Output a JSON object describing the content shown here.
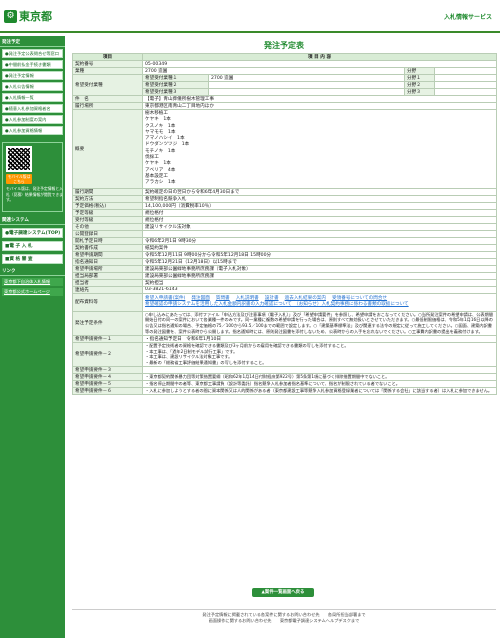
{
  "header": {
    "logo_text": "東京都",
    "service_title": "入札情報サービス"
  },
  "sidebar": {
    "head_label": "発注予定",
    "links": [
      "●発注予定公表問合せ等窓口",
      "●中間前払金手続き書類",
      "●発注予定情報",
      "●入札公告情報",
      "●入札情報一覧",
      "●随意入札参加資格者名",
      "●入札参加制度の案内",
      "●入札参加資格情報"
    ],
    "mobile": {
      "badge": "モバイル版はこちら",
      "text": "モバイル版は、発注予定情報と入札（見積）結果情報が閲覧できます。"
    },
    "system_head": "関連システム",
    "system_buttons": [
      "●電子調達システム(TOP)",
      "■電 子 入 札",
      "■資 格 審 査"
    ],
    "links_head": "リンク",
    "link_items": [
      "東京都下自治体入札情報",
      "東京都公式ホームページ"
    ]
  },
  "page": {
    "title": "発注予定表",
    "col_item": "項目",
    "col_content": "項 目 内 容",
    "rows": [
      {
        "label": "契約番号",
        "value": "05-00349"
      },
      {
        "label": "業種",
        "value": "2700 造園"
      },
      {
        "label": "業種",
        "value": ""
      }
    ],
    "contract_no": "05-00349",
    "gyoshu": "2700 造園",
    "bunya_label": "分野",
    "bunya1": "分野１",
    "bunya2": "分野２",
    "bunya3": "分野３",
    "kibo_label": "希望受付業種",
    "kibo1_label": "希望受付業種１",
    "kibo1_value": "2700 造園",
    "kibo2_label": "希望受付業種２",
    "kibo3_label": "希望受付業種３",
    "kenmei_label": "件　名",
    "kenmei_value": "【電子】青山葬儀所樹木管理工事",
    "basho_label": "履行場所",
    "basho_value": "東京都港区南青山二丁目地内ほか",
    "gaiyo_label": "概要",
    "gaiyo_lines": [
      "樹木移植工",
      "ケヤキ　1本",
      "クスノキ　1本",
      "ヤマモモ　1本",
      "アマノハシイ　1本",
      "ドウダンツツジ　1本",
      "モチノキ　1本",
      "伐採工",
      "ケヤキ　1本",
      "アベリア　4本",
      "基本設定工",
      "アラカシ　1本"
    ],
    "kikan_label": "履行期間",
    "kikan_value": "契約確定の日の翌日から令和6年4月30日まで",
    "hoho_label": "契約方法",
    "hoho_value": "希望制指名競争入札",
    "yotei_label": "予定価格(税込)",
    "yotei_value": "14,100,000円（消費税率10％）",
    "yoken_label": "予定等級",
    "yoken_value": "規位格付",
    "juryo_label": "受付等級",
    "juryo_value": "規位格付",
    "sonota_label": "その他",
    "sonota_value": "建設リサイクル法対象",
    "kokai_label": "公開登録日",
    "kokai_value": "",
    "kaisatsu_label": "開札予定日時",
    "kaisatsu_value": "令和6年2月1日 9時30分",
    "kessai_label": "契約書作成",
    "kessai_value": "紙契約案件",
    "kibo_uke_label": "希望申請期間",
    "kibo_uke_value": "令和5年12月11日 9時00分から令和5年12月18日 15時00分",
    "shimei_label": "指名通知日",
    "shimei_value": "令和5年12月21日（12月18日）以15時まで",
    "kibo_kyoku_label": "希望申請場所",
    "kibo_kyoku_value": "建設局東部公園緑地事務所庶務課（電子入札対象）",
    "tanto_label": "担当局部署",
    "tanto_value": "建設局東部公園緑地事務所庶務課",
    "tantosha_label": "担当者",
    "tantosha_value": "契約担当",
    "renraku_label": "連絡先",
    "renraku_value": "03-3821-6143",
    "haifu_label": "配布資料等",
    "haifu_links": [
      "希望入申請書(案件)",
      "発注図面",
      "質問書",
      "入札説明書",
      "設計書",
      "過去入札結果の案内",
      "受領番号についての問合せ"
    ],
    "haifu_note": "希望確認の申請システムを活用した入札金額内訳書の入力確認について　（お知らせ）入札契約事務に係わる書類の取扱について",
    "joken_label": "発注予定条件",
    "joken_text": "○申し込みにあたっては、添付ファイル「申込方法及び注意事項（電子入札）」及び「希望申請要件」を参照し、希望申請をおこなってください。○当所発注案件の希望申請は、公表期間開始日付の同一の案件において各業種一件のみです。同一業種に複数の希望申請を行った場合は、原則すべて無効扱いとさせていただきます。○最低制限価格は、令和5年1月16日以降の公告又は指名通知の場合、予定価格の75／100から93.5／100までの範囲で設定します。○「建築基準標準法」及び関連する法令の規定に従って施工してください。○図面、建築内訳書等の発注図書を、案件公表時から公開します。指名通知時には、原則発注図書を添付しないため、公表時からの入手を忘れないでください。○工事費内訳書の提出を義務付けます。",
    "youken_label": "希望申請要件",
    "youken": [
      {
        "no": "希望申請要件－１",
        "text": "・指名通知予定日　令和6年1月10日"
      },
      {
        "no": "希望申請要件－２",
        "text": "・配置予定技術者の資格を確認できる書類及び3ヶ月前からの雇用を確認できる書類の写しを添付すること。"
      },
      {
        "no": "希望申請要件－３",
        "text": ""
      },
      {
        "no": "希望申請要件－４",
        "text": "・東京都契約関係暴力団等対策措置要綱（昭和62年1月14日付財経庶第922号）第5条第1項に基づく排除措置期間中でないこと。"
      },
      {
        "no": "希望申請要件－５",
        "text": "・指名停止期間中の者等、東京都工事請負（設計等委託）指名競争入札参加者指名基準について、指名が制限されている者でないこと。"
      },
      {
        "no": "希望申請要件－６",
        "text": "・入札に参加しようとする者の間に資本関係又は人的関係がある者（東京都建設工事等競争入札参加資格登録業者については「関係する会社」に該当する者）は入札に参加できません。"
      }
    ],
    "youken2_lines": [
      "・本工事は、「過年2日制モデル試行工事」です。",
      "・本工事は、建設リサイクル法対象工事です。",
      "・最新の「総務省工事評価結果通知書」の写しを添付すること。"
    ],
    "back_button": "▲案件一覧画面へ戻る"
  },
  "footer": {
    "line1": "発注予定情報に掲載されている各案件に関するお問い合わせ先　　各局所担当部署まで",
    "line2": "画面操作に関するお問い合わせ先　　東京都電子調達システムヘルプデスクまで"
  }
}
